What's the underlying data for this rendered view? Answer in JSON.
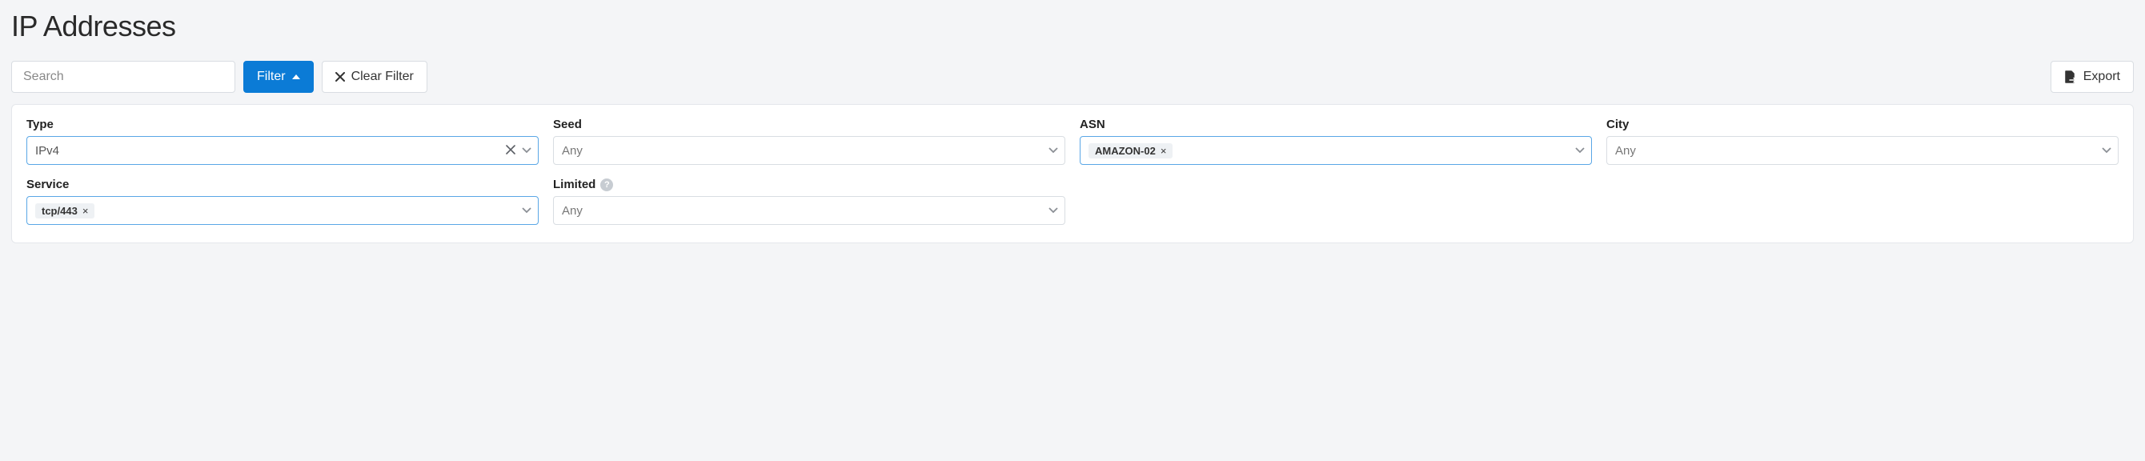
{
  "page": {
    "title": "IP Addresses"
  },
  "toolbar": {
    "search_placeholder": "Search",
    "filter_label": "Filter",
    "clear_label": "Clear Filter",
    "export_label": "Export"
  },
  "filters": {
    "type": {
      "label": "Type",
      "value": "IPv4",
      "active": true,
      "has_clear": true
    },
    "seed": {
      "label": "Seed",
      "value": "Any",
      "active": false,
      "placeholder": true
    },
    "asn": {
      "label": "ASN",
      "chip": "AMAZON-02",
      "active": true
    },
    "city": {
      "label": "City",
      "value": "Any",
      "active": false,
      "placeholder": true
    },
    "service": {
      "label": "Service",
      "chip": "tcp/443",
      "active": true
    },
    "limited": {
      "label": "Limited",
      "value": "Any",
      "active": false,
      "placeholder": true,
      "help": true
    }
  }
}
